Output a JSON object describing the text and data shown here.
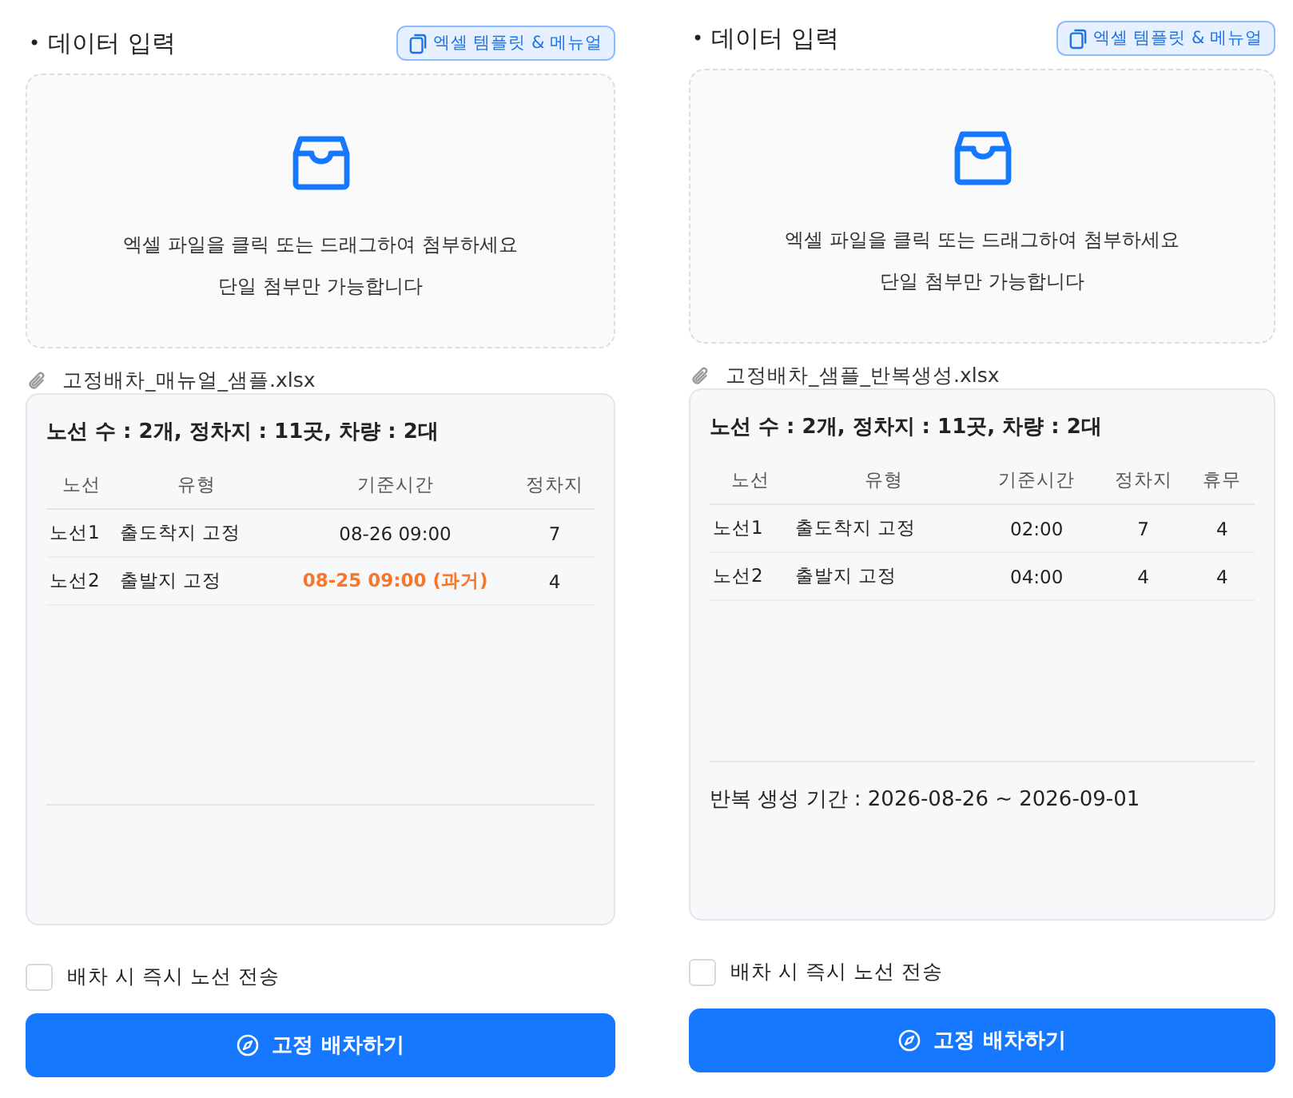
{
  "panels": [
    {
      "title_bullet": "•",
      "title": "데이터 입력",
      "template_button": "엑셀 템플릿 & 메뉴얼",
      "drop_text": "엑셀 파일을 클릭 또는 드래그하여 첨부하세요",
      "drop_hint": "단일 첨부만 가능합니다",
      "file_name": "고정배차_매뉴얼_샘플.xlsx",
      "summary": "노선 수 : 2개, 정차지 : 11곳, 차량 : 2대",
      "columns": [
        {
          "label": "노선",
          "kind": "text"
        },
        {
          "label": "유형",
          "kind": "text"
        },
        {
          "label": "기준시간",
          "kind": "time"
        },
        {
          "label": "정차지",
          "kind": "number"
        }
      ],
      "rows": [
        {
          "cells": [
            "노선1",
            "출도착지 고정",
            "08-26 09:00",
            "7"
          ],
          "past": false
        },
        {
          "cells": [
            "노선2",
            "출발지 고정",
            "08-25 09:00 (과거)",
            "4"
          ],
          "past": true
        }
      ],
      "checkbox": {
        "label": "배차 시 즉시 노선 전송",
        "checked": false
      },
      "submit_button": "고정 배차하기"
    },
    {
      "title_bullet": "•",
      "title": "데이터 입력",
      "template_button": "엑셀 템플릿 & 메뉴얼",
      "drop_text": "엑셀 파일을 클릭 또는 드래그하여 첨부하세요",
      "drop_hint": "단일 첨부만 가능합니다",
      "file_name": "고정배차_샘플_반복생성.xlsx",
      "summary": "노선 수 : 2개, 정차지 : 11곳, 차량 : 2대",
      "columns": [
        {
          "label": "노선",
          "kind": "text"
        },
        {
          "label": "유형",
          "kind": "text"
        },
        {
          "label": "기준시간",
          "kind": "time"
        },
        {
          "label": "정차지",
          "kind": "number"
        },
        {
          "label": "휴무",
          "kind": "number"
        }
      ],
      "rows": [
        {
          "cells": [
            "노선1",
            "출도착지 고정",
            "02:00",
            "7",
            "4"
          ],
          "past": false
        },
        {
          "cells": [
            "노선2",
            "출발지 고정",
            "04:00",
            "4",
            "4"
          ],
          "past": false
        }
      ],
      "footer_note": "반복 생성 기간 : 2026-08-26 ~ 2026-09-01",
      "checkbox": {
        "label": "배차 시 즉시 노선 전송",
        "checked": false
      },
      "submit_button": "고정 배차하기"
    }
  ]
}
